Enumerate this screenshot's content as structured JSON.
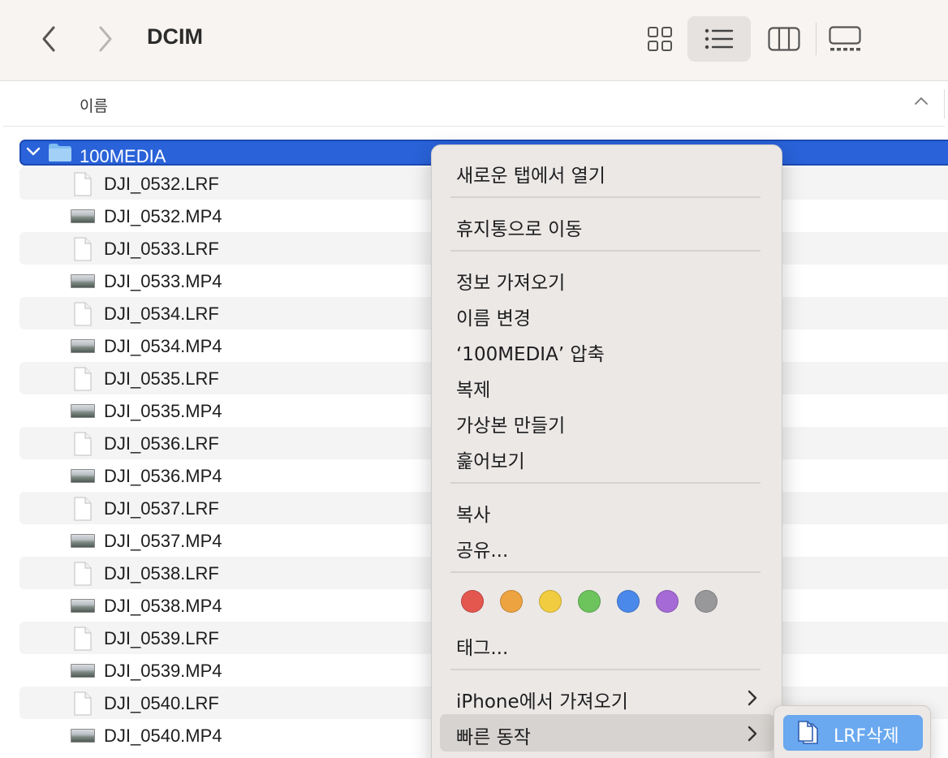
{
  "window": {
    "title": "DCIM"
  },
  "toolbar": {
    "back_icon": "chevron-left-icon",
    "forward_icon": "chevron-right-icon",
    "views": [
      {
        "name": "icon-view",
        "icon": "grid-icon",
        "active": false
      },
      {
        "name": "list-view",
        "icon": "list-icon",
        "active": true
      },
      {
        "name": "column-view",
        "icon": "columns-icon",
        "active": false
      },
      {
        "name": "gallery-view",
        "icon": "gallery-icon",
        "active": false
      }
    ]
  },
  "columns": {
    "name_header": "이름",
    "sort_icon": "chevron-up-icon"
  },
  "list": {
    "folder": {
      "name": "100MEDIA",
      "expanded": true,
      "selected": true
    },
    "files": [
      {
        "name": "DJI_0532.LRF",
        "kind": "document"
      },
      {
        "name": "DJI_0532.MP4",
        "kind": "video"
      },
      {
        "name": "DJI_0533.LRF",
        "kind": "document"
      },
      {
        "name": "DJI_0533.MP4",
        "kind": "video"
      },
      {
        "name": "DJI_0534.LRF",
        "kind": "document"
      },
      {
        "name": "DJI_0534.MP4",
        "kind": "video"
      },
      {
        "name": "DJI_0535.LRF",
        "kind": "document"
      },
      {
        "name": "DJI_0535.MP4",
        "kind": "video"
      },
      {
        "name": "DJI_0536.LRF",
        "kind": "document"
      },
      {
        "name": "DJI_0536.MP4",
        "kind": "video"
      },
      {
        "name": "DJI_0537.LRF",
        "kind": "document"
      },
      {
        "name": "DJI_0537.MP4",
        "kind": "video"
      },
      {
        "name": "DJI_0538.LRF",
        "kind": "document"
      },
      {
        "name": "DJI_0538.MP4",
        "kind": "video"
      },
      {
        "name": "DJI_0539.LRF",
        "kind": "document"
      },
      {
        "name": "DJI_0539.MP4",
        "kind": "video"
      },
      {
        "name": "DJI_0540.LRF",
        "kind": "document"
      },
      {
        "name": "DJI_0540.MP4",
        "kind": "video"
      }
    ]
  },
  "context_menu": {
    "open_new_tab": "새로운 탭에서 열기",
    "move_to_trash": "휴지통으로 이동",
    "get_info": "정보 가져오기",
    "rename": "이름 변경",
    "compress": "‘100MEDIA’ 압축",
    "duplicate": "복제",
    "make_alias": "가상본 만들기",
    "quick_look": "훑어보기",
    "copy": "복사",
    "share": "공유...",
    "tag_colors": [
      "#e3574f",
      "#eda33f",
      "#f2cc40",
      "#6dc35c",
      "#4a88ea",
      "#a56ad6",
      "#98989b"
    ],
    "tags": "태그...",
    "import_from_iphone": "iPhone에서 가져오기",
    "quick_actions": "빠른 동작"
  },
  "submenu": {
    "lrf_delete": "LRF삭제",
    "icon": "document-icon"
  }
}
